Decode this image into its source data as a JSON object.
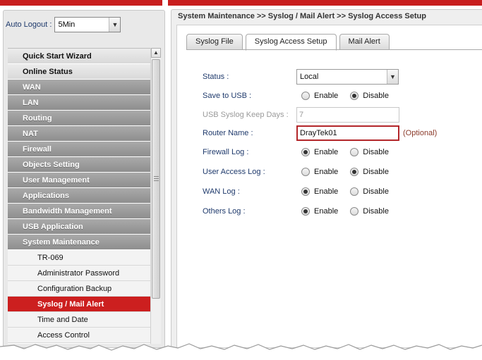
{
  "sidebar": {
    "auto_logout_label": "Auto Logout :",
    "auto_logout_value": "5Min",
    "menu": [
      {
        "label": "Quick Start Wizard",
        "style": "light"
      },
      {
        "label": "Online Status",
        "style": "light"
      },
      {
        "label": "WAN",
        "style": "dark"
      },
      {
        "label": "LAN",
        "style": "dark"
      },
      {
        "label": "Routing",
        "style": "dark"
      },
      {
        "label": "NAT",
        "style": "dark"
      },
      {
        "label": "Firewall",
        "style": "dark"
      },
      {
        "label": "Objects Setting",
        "style": "dark"
      },
      {
        "label": "User Management",
        "style": "dark"
      },
      {
        "label": "Applications",
        "style": "dark"
      },
      {
        "label": "Bandwidth Management",
        "style": "dark"
      },
      {
        "label": "USB Application",
        "style": "dark"
      },
      {
        "label": "System Maintenance",
        "style": "dark"
      }
    ],
    "submenu": [
      {
        "label": "TR-069",
        "active": false
      },
      {
        "label": "Administrator Password",
        "active": false
      },
      {
        "label": "Configuration Backup",
        "active": false
      },
      {
        "label": "Syslog / Mail Alert",
        "active": true
      },
      {
        "label": "Time and Date",
        "active": false
      },
      {
        "label": "Access Control",
        "active": false
      }
    ]
  },
  "breadcrumb": "System Maintenance >> Syslog / Mail Alert >> Syslog Access Setup",
  "tabs": [
    {
      "label": "Syslog File",
      "active": false
    },
    {
      "label": "Syslog Access Setup",
      "active": true
    },
    {
      "label": "Mail Alert",
      "active": false
    }
  ],
  "form": {
    "status": {
      "label": "Status :",
      "value": "Local"
    },
    "save_usb": {
      "label": "Save to USB :",
      "enable": "Enable",
      "disable": "Disable",
      "selected": "disable"
    },
    "usb_keep_days": {
      "label": "USB Syslog Keep Days :",
      "value": "7"
    },
    "router_name": {
      "label": "Router Name :",
      "value": "DrayTek01",
      "hint": "(Optional)"
    },
    "firewall_log": {
      "label": "Firewall Log :",
      "enable": "Enable",
      "disable": "Disable",
      "selected": "enable"
    },
    "user_access_log": {
      "label": "User Access Log :",
      "enable": "Enable",
      "disable": "Disable",
      "selected": "disable"
    },
    "wan_log": {
      "label": "WAN Log :",
      "enable": "Enable",
      "disable": "Disable",
      "selected": "enable"
    },
    "others_log": {
      "label": "Others Log :",
      "enable": "Enable",
      "disable": "Disable",
      "selected": "enable"
    }
  },
  "colors": {
    "accent_red": "#cc1f1f",
    "label_blue": "#1f3a6c"
  }
}
